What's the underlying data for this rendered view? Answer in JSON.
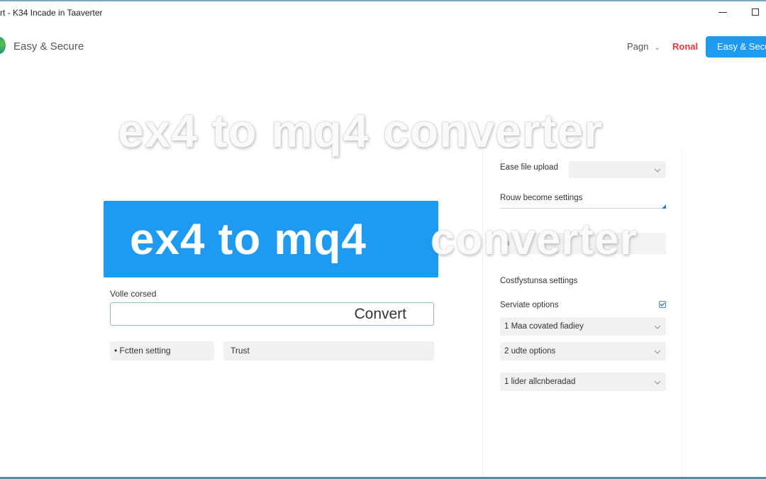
{
  "window": {
    "title": "rt - K34 Incade in Taaverter",
    "controls": {
      "minimize": "minimize",
      "maximize": "maximize"
    }
  },
  "header": {
    "brand": "Easy & Secure",
    "nav": {
      "pagn": "Pagn",
      "ronal": "Ronal"
    },
    "cta": "Easy & Secure"
  },
  "hero": {
    "ghost_title": "ex4 to mq4 converter",
    "banner_main": "ex4 to mq4",
    "banner_overflow": "converter"
  },
  "form": {
    "field_label": "Volle corsed",
    "convert_label": "Convert",
    "options": [
      {
        "label": "• Fctten setting"
      },
      {
        "label": "Trust"
      }
    ]
  },
  "settings_panel": {
    "file_upload_label": "Ease file upload",
    "file_upload_value": "",
    "row_settings_label": "Rouw become settings",
    "tiny_text": "Ivi",
    "section_label": "Costfystunsa settings",
    "checkbox_label": "Serviate options",
    "checkbox_checked": true,
    "dropdowns": [
      {
        "value": "1 Maa covated fiadiey"
      },
      {
        "value": "2 udte options"
      },
      {
        "value": "1 lider allcnberadad"
      }
    ]
  },
  "colors": {
    "accent": "#1e9bf0",
    "nav_highlight": "#e03a3e"
  }
}
